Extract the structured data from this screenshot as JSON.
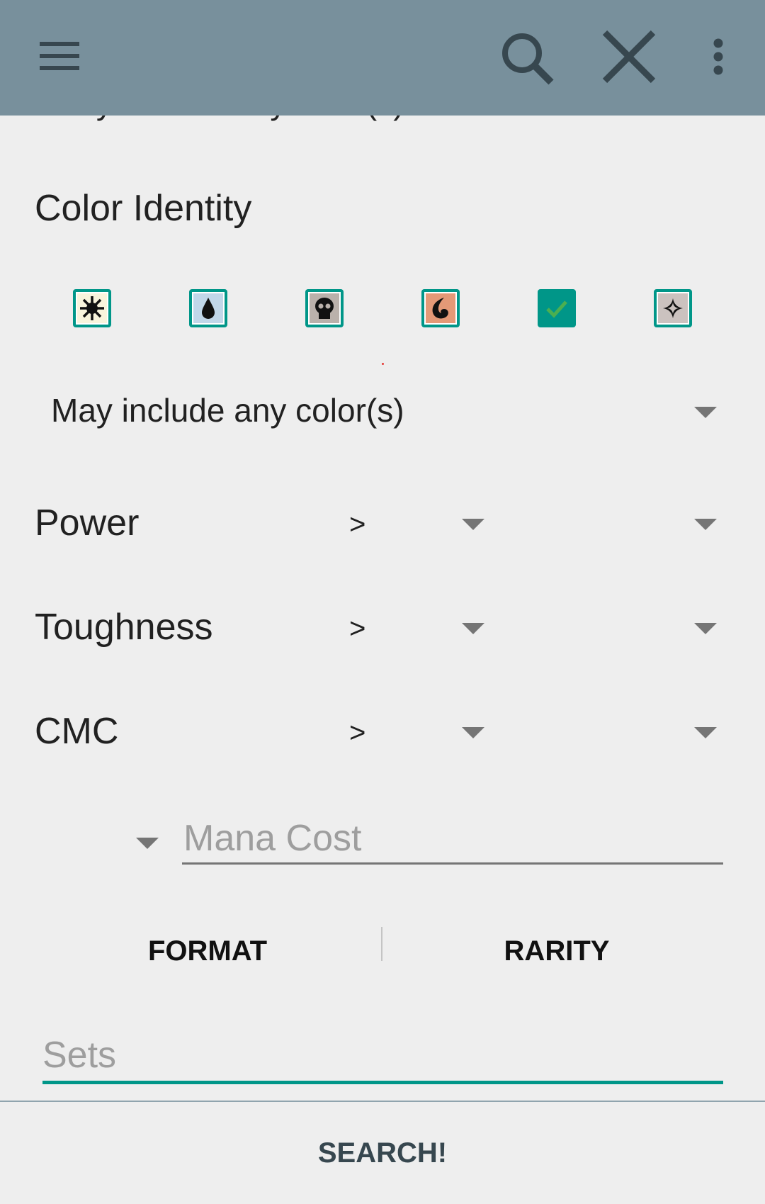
{
  "toolbar": {
    "menu_icon": "hamburger-menu-icon",
    "search_icon": "search-icon",
    "clear_icon": "close-icon",
    "overflow_icon": "more-vert-icon"
  },
  "colors": {
    "appbar": "#78909c",
    "accent": "#009688",
    "background": "#eeeeee"
  },
  "color_selection": {
    "previous_dropdown_text": "May include any color(s)"
  },
  "color_identity": {
    "label": "Color Identity",
    "symbols": [
      {
        "name": "white-mana-icon",
        "checked": false
      },
      {
        "name": "blue-mana-icon",
        "checked": false
      },
      {
        "name": "black-mana-icon",
        "checked": false
      },
      {
        "name": "red-mana-icon",
        "checked": false
      },
      {
        "name": "green-mana-checkbox-checked",
        "checked": true
      },
      {
        "name": "colorless-mana-icon",
        "checked": false
      }
    ],
    "mode_selected": "May include any color(s)"
  },
  "power": {
    "label": "Power",
    "operator": ">",
    "value": ""
  },
  "toughness": {
    "label": "Toughness",
    "operator": ">",
    "value": ""
  },
  "cmc": {
    "label": "CMC",
    "operator": ">",
    "value": ""
  },
  "mana_cost": {
    "placeholder": "Mana Cost",
    "value": ""
  },
  "tabs": {
    "format_label": "FORMAT",
    "rarity_label": "RARITY"
  },
  "sets": {
    "placeholder": "Sets",
    "value": ""
  },
  "search_button_label": "SEARCH!"
}
